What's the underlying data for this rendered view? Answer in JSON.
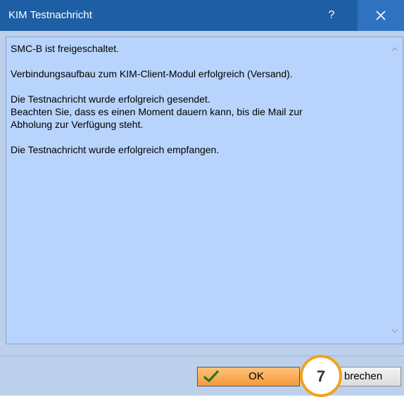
{
  "window": {
    "title": "KIM Testnachricht",
    "help_label": "?",
    "title_bar_color": "#1d5ea5",
    "close_button_color": "#2f73c0"
  },
  "message": {
    "text": "SMC-B ist freigeschaltet.\n\nVerbindungsaufbau zum KIM-Client-Modul erfolgreich (Versand).\n\nDie Testnachricht wurde erfolgreich gesendet.\nBeachten Sie, dass es einen Moment dauern kann, bis die Mail zur\nAbholung zur Verfügung steht.\n\nDie Testnachricht wurde erfolgreich empfangen.",
    "background_color": "#b8d4fc"
  },
  "buttons": {
    "ok_label": "OK",
    "ok_icon": "green-checkmark-icon",
    "cancel_label_visible": "brechen"
  },
  "annotation": {
    "step_number": "7",
    "marker_color": "#f0a21d"
  },
  "icons": {
    "close": "close-icon",
    "scroll_up": "chevron-up-icon",
    "scroll_down": "chevron-down-icon"
  }
}
